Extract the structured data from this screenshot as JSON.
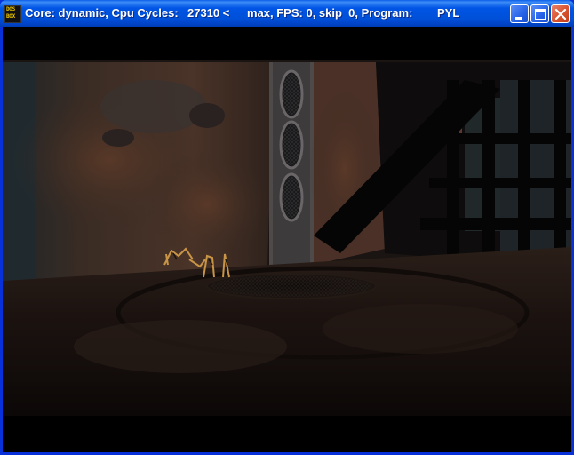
{
  "window": {
    "title_core": "Core: dynamic, Cpu Cycles:",
    "title_cycles": "27310 <",
    "title_rest": "max, FPS: 0, skip  0, Program:",
    "title_program": "PYL",
    "icon_line1": "DOS",
    "icon_line2": "BOX"
  },
  "controls": {
    "minimize_icon": "minimize-icon",
    "maximize_icon": "maximize-icon",
    "close_icon": "close-icon"
  },
  "colors": {
    "titlebar": "#0055e5",
    "close_button": "#d9532e",
    "frame": "#0831d9"
  }
}
